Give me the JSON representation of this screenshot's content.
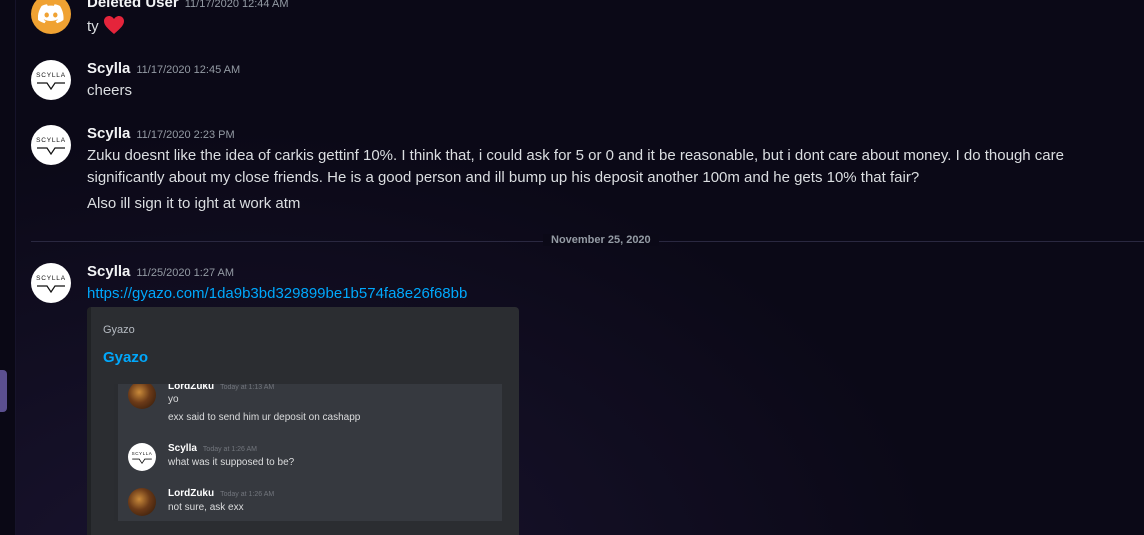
{
  "messages": [
    {
      "author": "Deleted User",
      "timestamp": "11/17/2020 12:44 AM",
      "text": "ty",
      "reaction_icon": "heart-icon",
      "avatar_icon": "discord-logo-icon"
    },
    {
      "author": "Scylla",
      "timestamp": "11/17/2020 12:45 AM",
      "text": "cheers",
      "avatar_text": "SCYLLA"
    },
    {
      "author": "Scylla",
      "timestamp": "11/17/2020 2:23 PM",
      "lines": [
        "Zuku doesnt like the idea of carkis gettinf 10%.  I think that, i could ask for 5 or 0 and it be reasonable, but i dont care about money. I do though care significantly about my close friends. He is a good person and ill bump up his deposit another 100m and he gets 10%  that fair?",
        "Also ill sign it to ight at work atm"
      ],
      "avatar_text": "SCYLLA"
    }
  ],
  "date_divider": "November 25, 2020",
  "link_message": {
    "author": "Scylla",
    "timestamp": "11/25/2020 1:27 AM",
    "link": "https://gyazo.com/1da9b3bd329899be1b574fa8e26f68bb",
    "avatar_text": "SCYLLA"
  },
  "embed": {
    "provider": "Gyazo",
    "title": "Gyazo",
    "preview": [
      {
        "author": "LordZuku",
        "timestamp": "Today at 1:13 AM",
        "lines": [
          "yo",
          "exx said to send him ur deposit on cashapp"
        ]
      },
      {
        "author": "Scylla",
        "timestamp": "Today at 1:26 AM",
        "lines": [
          "what was it supposed to be?"
        ]
      },
      {
        "author": "LordZuku",
        "timestamp": "Today at 1:26 AM",
        "lines": [
          "not sure, ask exx"
        ]
      }
    ]
  },
  "colors": {
    "background": "#0b0917",
    "link": "#00a8fc",
    "heart": "#e5243b",
    "discord_avatar": "#f0a232"
  }
}
